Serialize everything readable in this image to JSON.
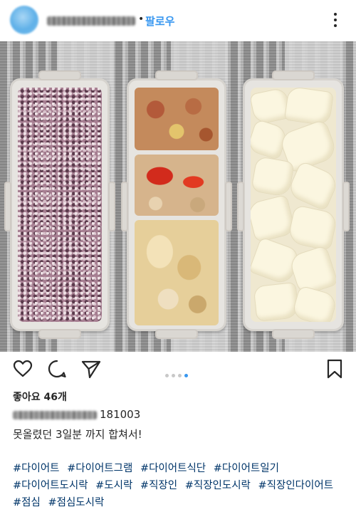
{
  "header": {
    "username_blurred": "@luna_friendship",
    "separator": "•",
    "follow_label": "팔로우",
    "accent_color": "#3897f0"
  },
  "photo": {
    "subject": "three lunchboxes: multigrain rice, stir-fried side dishes, sliced pear"
  },
  "carousel": {
    "total": 4,
    "active_index": 3
  },
  "post": {
    "likes_label": "좋아요 46개",
    "caption_date": "181003",
    "caption_text": "못올렸던 3일분 까지 합쳐서!",
    "hashtags": [
      "#다이어트",
      "#다이어트그램",
      "#다이어트식단",
      "#다이어트일기",
      "#다이어트도시락",
      "#도시락",
      "#직장인",
      "#직장인도시락",
      "#직장인다이어트",
      "#점심",
      "#점심도시락"
    ]
  },
  "icons": [
    "more-vertical-icon",
    "heart-icon",
    "comment-icon",
    "share-icon",
    "bookmark-icon"
  ]
}
